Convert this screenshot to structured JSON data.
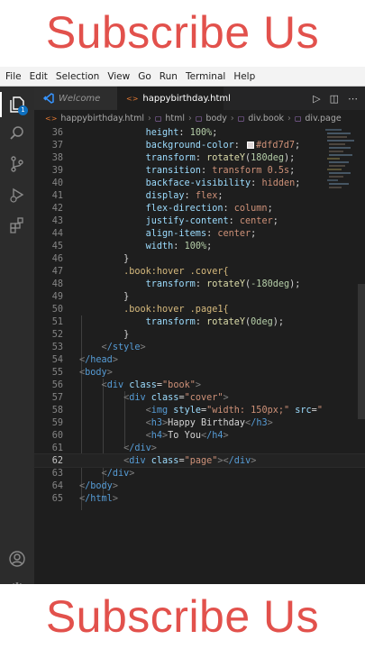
{
  "banner_top": "Subscribe Us",
  "banner_bottom": "Subscribe Us",
  "menu": [
    "File",
    "Edit",
    "Selection",
    "View",
    "Go",
    "Run",
    "Terminal",
    "Help"
  ],
  "activity_badges": {
    "explorer": "1",
    "settings": "1"
  },
  "tabs": [
    {
      "label": "Welcome",
      "active": false
    },
    {
      "label": "happybirthday.html",
      "active": true,
      "modified": true
    }
  ],
  "breadcrumb": [
    "happybirthday.html",
    "html",
    "body",
    "div.book",
    "div.page"
  ],
  "swatch_color": "#dfd7d7",
  "code": {
    "l36": {
      "n": "36",
      "prop": "height",
      "val": "100%"
    },
    "l37": {
      "n": "37",
      "prop": "background-color",
      "val": "#dfd7d7"
    },
    "l38": {
      "n": "38",
      "prop": "transform",
      "fn": "rotateY",
      "arg": "180deg"
    },
    "l39": {
      "n": "39",
      "prop": "transition",
      "val": "transform 0.5s"
    },
    "l40": {
      "n": "40",
      "prop": "backface-visibility",
      "val": "hidden"
    },
    "l41": {
      "n": "41",
      "prop": "display",
      "val": "flex"
    },
    "l42": {
      "n": "42",
      "prop": "flex-direction",
      "val": "column"
    },
    "l43": {
      "n": "43",
      "prop": "justify-content",
      "val": "center"
    },
    "l44": {
      "n": "44",
      "prop": "align-items",
      "val": "center"
    },
    "l45": {
      "n": "45",
      "prop": "width",
      "val": "100%"
    },
    "l46": {
      "n": "46",
      "text": "}"
    },
    "l47": {
      "n": "47",
      "sel": ".book:hover .cover{"
    },
    "l48": {
      "n": "48",
      "prop": "transform",
      "fn": "rotateY",
      "arg": "-180deg"
    },
    "l49": {
      "n": "49",
      "text": "}"
    },
    "l50": {
      "n": "50",
      "sel": ".book:hover .page1{"
    },
    "l51": {
      "n": "51",
      "prop": "transform",
      "fn": "rotateY",
      "arg": "0deg"
    },
    "l52": {
      "n": "52",
      "text": "}"
    },
    "l53": {
      "n": "53",
      "tag": "/style"
    },
    "l54": {
      "n": "54",
      "tag": "/head"
    },
    "l55": {
      "n": "55",
      "tag": "body"
    },
    "l56": {
      "n": "56",
      "tag": "div",
      "attr": "class",
      "str": "\"book\""
    },
    "l57": {
      "n": "57",
      "tag": "div",
      "attr": "class",
      "str": "\"cover\""
    },
    "l58": {
      "n": "58",
      "tag": "img",
      "attr": "style",
      "str": "\"width: 150px;\"",
      "attr2": "src",
      "str2": "\""
    },
    "l59": {
      "n": "59",
      "tag": "h3",
      "txt": "Happy Birthday",
      "close": "/h3"
    },
    "l60": {
      "n": "60",
      "tag": "h4",
      "txt": "To You",
      "close": "/h4"
    },
    "l61": {
      "n": "61",
      "tag": "/div"
    },
    "l62": {
      "n": "62",
      "tag": "div",
      "attr": "class",
      "str": "\"page\"",
      "close": "/div"
    },
    "l63": {
      "n": "63",
      "tag": "/div"
    },
    "l64": {
      "n": "64",
      "tag": "/body"
    },
    "l65": {
      "n": "65",
      "tag": "/html"
    }
  }
}
